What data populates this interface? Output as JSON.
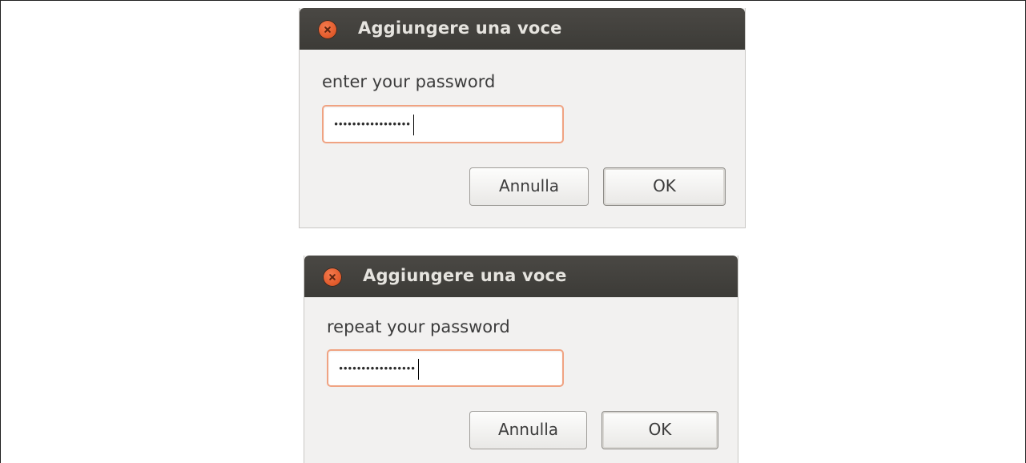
{
  "dialogs": [
    {
      "title": "Aggiungere una voce",
      "prompt": "enter your password",
      "password_mask": "•••••••••••••••••",
      "cancel_label": "Annulla",
      "ok_label": "OK"
    },
    {
      "title": "Aggiungere una voce",
      "prompt": "repeat your password",
      "password_mask": "•••••••••••••••••",
      "cancel_label": "Annulla",
      "ok_label": "OK"
    }
  ],
  "icons": {
    "close": "close-icon"
  },
  "colors": {
    "titlebar": "#3c3b37",
    "title_text": "#e6e4df",
    "close_button": "#e45e2f",
    "dialog_bg": "#f2f1f0",
    "field_focus_border": "#f0a382"
  }
}
